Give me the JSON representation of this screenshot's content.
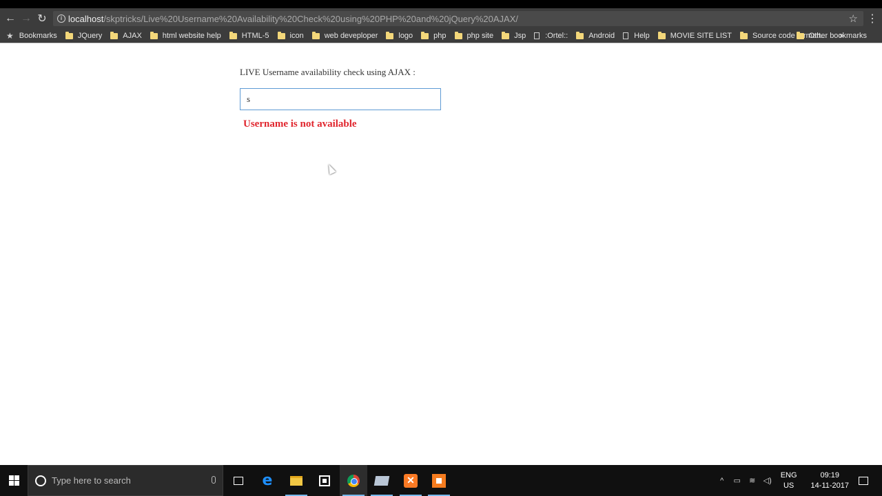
{
  "browser": {
    "url_host": "localhost",
    "url_path": "/skptricks/Live%20Username%20Availability%20Check%20using%20PHP%20and%20jQuery%20AJAX/"
  },
  "bookmarks": {
    "label": "Bookmarks",
    "items": [
      {
        "label": "JQuery",
        "icon": "folder-icon"
      },
      {
        "label": "AJAX",
        "icon": "folder-icon"
      },
      {
        "label": "html website help",
        "icon": "folder-icon"
      },
      {
        "label": "HTML-5",
        "icon": "folder-icon"
      },
      {
        "label": "icon",
        "icon": "folder-icon"
      },
      {
        "label": "web deveploper",
        "icon": "folder-icon"
      },
      {
        "label": "logo",
        "icon": "folder-icon"
      },
      {
        "label": "php",
        "icon": "folder-icon"
      },
      {
        "label": "php site",
        "icon": "folder-icon"
      },
      {
        "label": "Jsp",
        "icon": "folder-icon"
      },
      {
        "label": ":Ortel::",
        "icon": "page-icon"
      },
      {
        "label": "Android",
        "icon": "folder-icon"
      },
      {
        "label": "Help",
        "icon": "page-icon"
      },
      {
        "label": "MOVIE SITE LIST",
        "icon": "folder-icon"
      },
      {
        "label": "Source code formatt...",
        "icon": "folder-icon"
      }
    ],
    "more": "»",
    "other": "Other bookmarks"
  },
  "page": {
    "heading": "LIVE Username availability check using AJAX :",
    "input_value": "s",
    "status_message": "Username is not available",
    "status_color": "#e0252d"
  },
  "taskbar": {
    "search_placeholder": "Type here to search",
    "lang_top": "ENG",
    "lang_bottom": "US",
    "time": "09:19",
    "date": "14-11-2017"
  }
}
